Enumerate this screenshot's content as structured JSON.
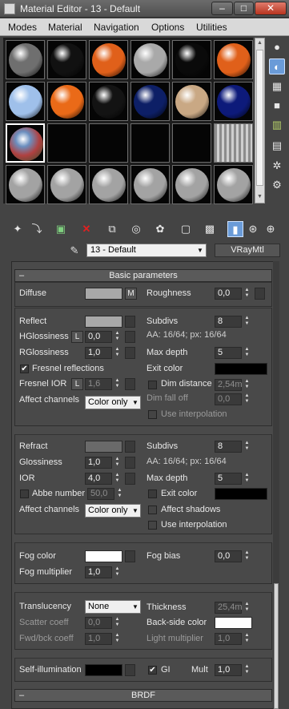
{
  "window": {
    "title": "Material Editor - 13 - Default",
    "min": "–",
    "max": "□",
    "close": "✕"
  },
  "menu": [
    "Modes",
    "Material",
    "Navigation",
    "Options",
    "Utilities"
  ],
  "slots": {
    "rows": [
      [
        "#6f6f6f",
        "#111111",
        "#e0601a",
        "#a9a9a9",
        "#0a0a0a",
        "#e0601a"
      ],
      [
        "#9fc0ea",
        "#ea6a18",
        "#131313",
        "#0d1f66",
        "#c9a884",
        "#0d1a7a"
      ],
      [
        "#b04040",
        "#000000",
        "#000000",
        "#000000",
        "#000000",
        "#bdbdbd"
      ],
      [
        "#a3a3a3",
        "#a3a3a3",
        "#a3a3a3",
        "#a3a3a3",
        "#a3a3a3",
        "#a3a3a3"
      ]
    ]
  },
  "toolbar_icons": [
    "get-material-icon",
    "put-to-scene-icon",
    "assign-to-selection-icon",
    "reset-icon",
    "make-copy-icon",
    "make-unique-icon",
    "put-to-library-icon",
    "material-id-icon",
    "show-map-icon",
    "show-end-result-icon",
    "go-to-parent-icon",
    "go-forward-icon"
  ],
  "right_icons": [
    "sample-type-icon",
    "backlight-icon",
    "background-icon",
    "uv-tiling-icon",
    "video-color-check-icon",
    "make-preview-icon",
    "options-icon",
    "select-by-material-icon"
  ],
  "material_name": "13 - Default",
  "material_type": "VRayMtl",
  "basic": {
    "header": "Basic parameters",
    "diffuse": {
      "label": "Diffuse",
      "m": "M",
      "roughness_label": "Roughness",
      "roughness": "0,0",
      "color": "#a8a8a8"
    },
    "reflect": {
      "label": "Reflect",
      "color": "#a8a8a8",
      "hgloss_label": "HGlossiness",
      "hgloss_lock": "L",
      "hgloss": "0,0",
      "rgloss_label": "RGlossiness",
      "rgloss": "1,0",
      "fresnel_label": "Fresnel reflections",
      "fresnel_checked": "✔",
      "fresnel_ior_label": "Fresnel IOR",
      "fresnel_ior_lock": "L",
      "fresnel_ior": "1,6",
      "affect_label": "Affect channels",
      "affect_value": "Color only",
      "subdivs_label": "Subdivs",
      "subdivs": "8",
      "aa_info": "AA: 16/64; px: 16/64",
      "maxdepth_label": "Max depth",
      "maxdepth": "5",
      "exit_label": "Exit color",
      "exit_color": "#000000",
      "dimdist_label": "Dim distance",
      "dimdist": "2,54m",
      "dimfall_label": "Dim fall off",
      "dimfall": "0,0",
      "interp_label": "Use interpolation"
    },
    "refract": {
      "label": "Refract",
      "color": "#6a6a6a",
      "gloss_label": "Glossiness",
      "gloss": "1,0",
      "ior_label": "IOR",
      "ior": "4,0",
      "abbe_label": "Abbe number",
      "abbe": "50,0",
      "affect_label": "Affect channels",
      "affect_value": "Color only",
      "subdivs_label": "Subdivs",
      "subdivs": "8",
      "aa_info": "AA: 16/64; px: 16/64",
      "maxdepth_label": "Max depth",
      "maxdepth": "5",
      "exit_label": "Exit color",
      "exit_color": "#000000",
      "shadows_label": "Affect shadows",
      "interp_label": "Use interpolation"
    },
    "fog": {
      "color_label": "Fog color",
      "color": "#ffffff",
      "mult_label": "Fog multiplier",
      "mult": "1,0",
      "bias_label": "Fog bias",
      "bias": "0,0"
    },
    "translucency": {
      "label": "Translucency",
      "value": "None",
      "scatter_label": "Scatter coeff",
      "scatter": "0,0",
      "fwd_label": "Fwd/bck coeff",
      "fwd": "1,0",
      "thickness_label": "Thickness",
      "thickness": "25,4m",
      "backside_label": "Back-side color",
      "backside_color": "#ffffff",
      "lightmult_label": "Light multiplier",
      "lightmult": "1,0"
    },
    "selfillum": {
      "label": "Self-illumination",
      "color": "#000000",
      "gi_label": "GI",
      "gi_checked": "✔",
      "mult_label": "Mult",
      "mult": "1,0"
    }
  },
  "brdf_header": "BRDF",
  "collapse_symbol": "–"
}
